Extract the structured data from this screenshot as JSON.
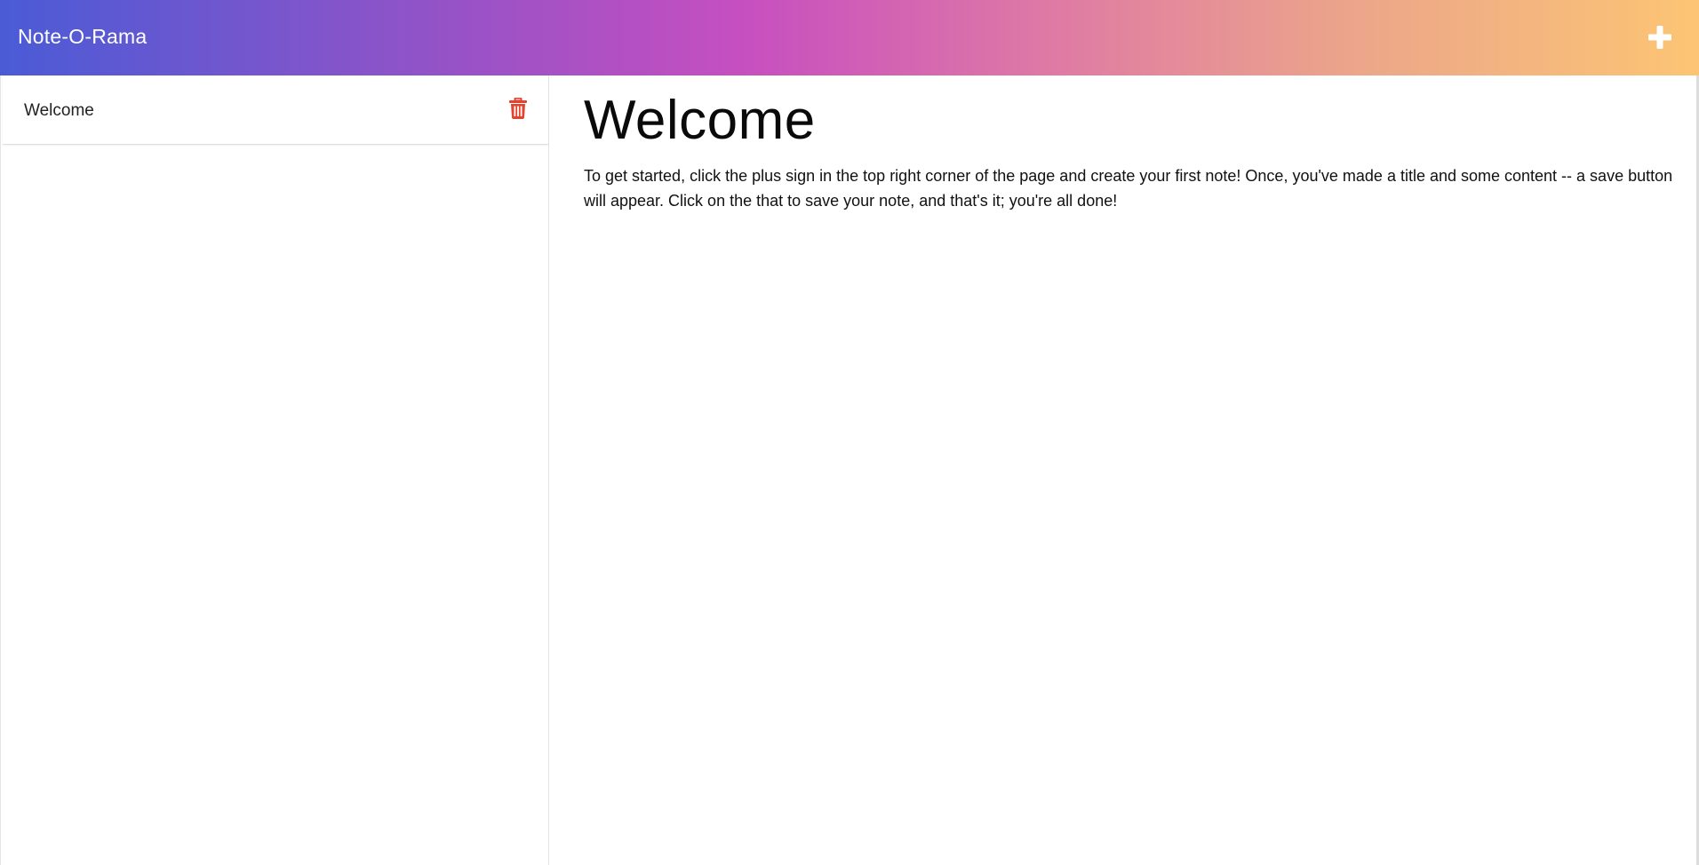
{
  "header": {
    "app_title": "Note-O-Rama",
    "add_icon": "plus-icon"
  },
  "sidebar": {
    "notes": [
      {
        "title": "Welcome",
        "delete_icon": "trash-icon"
      }
    ]
  },
  "note": {
    "title": "Welcome",
    "body": "To get started, click the plus sign in the top right corner of the page and create your first note! Once, you've made a title and some content -- a save button will appear. Click on the that to save your note, and that's it; you're all done!"
  },
  "colors": {
    "gradient_start": "#4a5bd6",
    "gradient_mid": "#c74fc0",
    "gradient_end": "#fcc574",
    "delete_red": "#e2432f"
  }
}
